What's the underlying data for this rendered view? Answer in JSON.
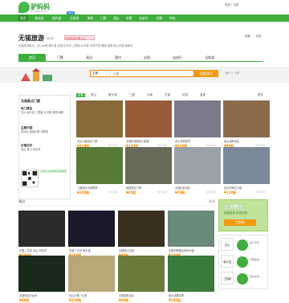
{
  "site": {
    "logo_text": "驴妈妈",
    "logo_sub": "lvmama.com",
    "hot": "HOT",
    "login": "登录 | 注册"
  },
  "nav": [
    "首页",
    "周边游",
    "国内游",
    "出境游",
    "邮轮",
    "门票",
    "酒店",
    "机票",
    "自由行",
    "团购",
    "特卖"
  ],
  "city": {
    "name": "无锡旅游",
    "en": "wuxi",
    "pink_btn": "无锡旅游攻略大全",
    "line": "无锡旅游景点：灵山大佛 鼋头渚 太湖 拈花湾 三国城 水浒城 东林书院 梅园 蠡园 惠山古镇 南禅寺"
  },
  "city_icons": [
    "攻略",
    "问答"
  ],
  "tabs": [
    "首页",
    "门票",
    "周边",
    "国内",
    "出境",
    "自由行",
    "当地游"
  ],
  "search": {
    "select": "无锡",
    "placeholder": "无锡",
    "button": "搜索景点",
    "breadcrumb": "首页 > 无锡"
  },
  "sidebar": {
    "title": "无锡景点门票",
    "blocks": [
      {
        "title": "热门景区",
        "items": "灵山 鼋头渚 三国城 水浒城 蠡园 梅园"
      },
      {
        "title": "主题乐园",
        "items": "嬉戏谷 融创乐园 动物园"
      },
      {
        "title": "古镇古村",
        "items": "惠山 荡口 拈花湾"
      }
    ],
    "qr_text": "扫码关注驴妈妈无锡旅游"
  },
  "strip": [
    "全部",
    "灵山",
    "鼋头渚",
    "三国",
    "太湖",
    "古镇",
    "乐园",
    "温泉",
    "更多"
  ],
  "cards": [
    {
      "title": "灵山大佛景区门票",
      "price": "¥210起",
      "tag": "可订今日",
      "color": "#8a6a3a"
    },
    {
      "title": "无锡影视基地三国城",
      "price": "¥130起",
      "tag": "可订今日",
      "color": "#9a5b3b"
    },
    {
      "title": "灵山梵宫胜境",
      "price": "¥210起",
      "tag": "可订今日",
      "color": "#7a7a8a"
    },
    {
      "title": "鼋头渚风景区",
      "price": "¥90起",
      "tag": "可订今日",
      "color": "#8b6b4b"
    },
    {
      "title": "三国城水浒城联票",
      "price": "¥180起",
      "tag": "可订今日",
      "color": "#5a7a3a"
    },
    {
      "title": "蠡园景区门票",
      "price": "¥45起",
      "tag": "可订今日",
      "color": "#6a6a5a"
    },
    {
      "title": "太湖仙岛景区",
      "price": "¥70起",
      "tag": "可订今日",
      "color": "#9aa2a8"
    },
    {
      "title": "拈花湾禅意小镇",
      "price": "¥120起",
      "tag": "可订今日",
      "color": "#7a8898"
    }
  ],
  "section2": {
    "title": "周边",
    "more": "更多"
  },
  "gcards": [
    {
      "title": "无锡二日游 灵山 拈花湾",
      "price": "¥398起",
      "color": "#2a2a2a"
    },
    {
      "title": "无锡一日游 鼋头渚",
      "price": "¥168起",
      "color": "#1a1a2a"
    },
    {
      "title": "无锡惠山古镇",
      "price": "¥98起",
      "color": "#3a3020"
    },
    {
      "title": "无锡动物园太湖欢乐园",
      "price": "¥150起",
      "color": "#6a8a7a"
    },
    {
      "title": "无锡夜游古运河",
      "price": "¥80起",
      "color": "#1a2a1a"
    },
    {
      "title": "灵山大佛一日游",
      "price": "¥220起",
      "color": "#b8a878"
    },
    {
      "title": "无锡园林景区",
      "price": "¥60起",
      "color": "#6a7a3a"
    },
    {
      "title": "鼋头渚樱花季",
      "price": "¥105起",
      "color": "#3a7a3a"
    }
  ],
  "ad": {
    "t1": "出游精选",
    "t2": "优惠多多 天天出发",
    "btn": "立即抢"
  },
  "ranks": [
    {
      "name": "灵山",
      "desc": "热门景区"
    },
    {
      "name": "鼋头渚",
      "desc": "赏樱胜地"
    },
    {
      "name": "三国城",
      "desc": "影视基地"
    }
  ],
  "colors": {
    "brand": "#3fae3f",
    "accent": "#f29a12"
  }
}
